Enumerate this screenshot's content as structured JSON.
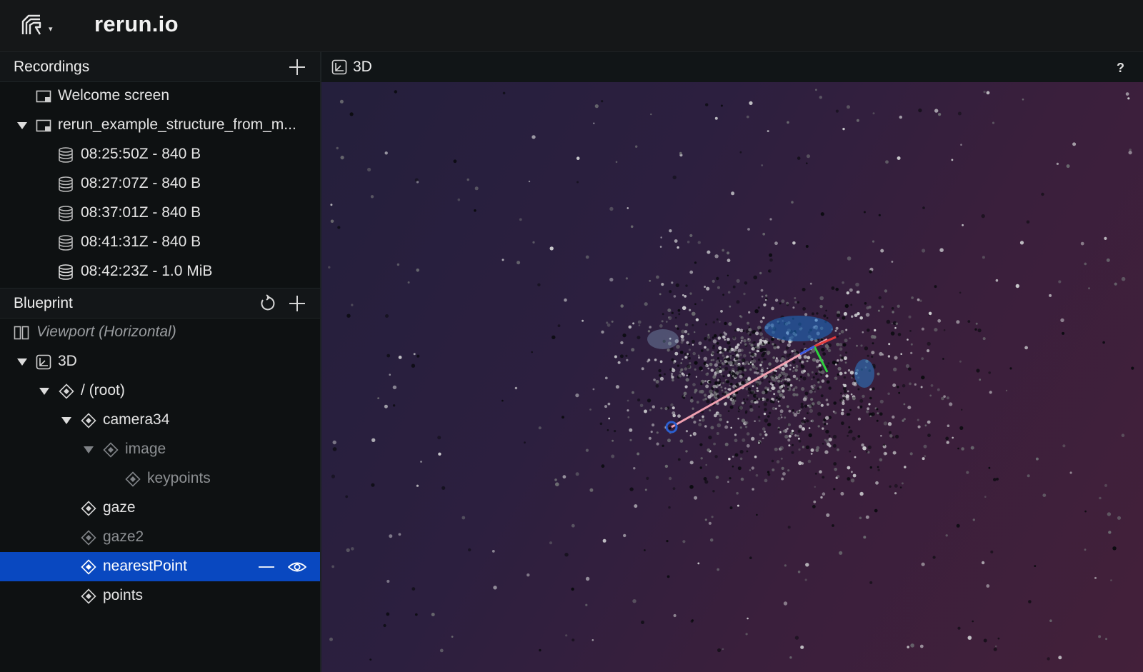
{
  "app": {
    "title": "rerun.io",
    "logo_icon": "rerun-logo-icon",
    "menu_caret": "▾"
  },
  "recordings": {
    "title": "Recordings",
    "items": [
      {
        "label": "Welcome screen",
        "icon": "screen-icon"
      },
      {
        "label": "rerun_example_structure_from_m...",
        "icon": "screen-icon",
        "expanded": true
      },
      {
        "label": "08:25:50Z - 840 B",
        "icon": "database-icon"
      },
      {
        "label": "08:27:07Z - 840 B",
        "icon": "database-icon"
      },
      {
        "label": "08:37:01Z - 840 B",
        "icon": "database-icon"
      },
      {
        "label": "08:41:31Z - 840 B",
        "icon": "database-icon"
      },
      {
        "label": "08:42:23Z - 1.0 MiB",
        "icon": "database-icon"
      }
    ]
  },
  "blueprint": {
    "title": "Blueprint",
    "items": [
      {
        "label": "Viewport (Horizontal)",
        "icon": "split-view-icon"
      },
      {
        "label": "3D",
        "icon": "3d-view-icon"
      },
      {
        "label": "/ (root)",
        "icon": "entity-icon"
      },
      {
        "label": "camera34",
        "icon": "entity-icon"
      },
      {
        "label": "image",
        "icon": "entity-icon"
      },
      {
        "label": "keypoints",
        "icon": "entity-icon"
      },
      {
        "label": "gaze",
        "icon": "entity-icon"
      },
      {
        "label": "gaze2",
        "icon": "entity-icon"
      },
      {
        "label": "nearestPoint",
        "icon": "entity-icon",
        "selected": true
      },
      {
        "label": "points",
        "icon": "entity-icon"
      }
    ]
  },
  "viewport": {
    "tab_label": "3D",
    "help": "?",
    "background_colors": [
      "#241f3c",
      "#43203a"
    ],
    "arrow_colors": {
      "x": "#e23b3b",
      "y": "#2fd13f",
      "z": "#3b5ae2",
      "gaze": "#f0a0b0"
    }
  },
  "colors": {
    "selection": "#0948c0",
    "sidebar_bg": "#0e1112"
  }
}
